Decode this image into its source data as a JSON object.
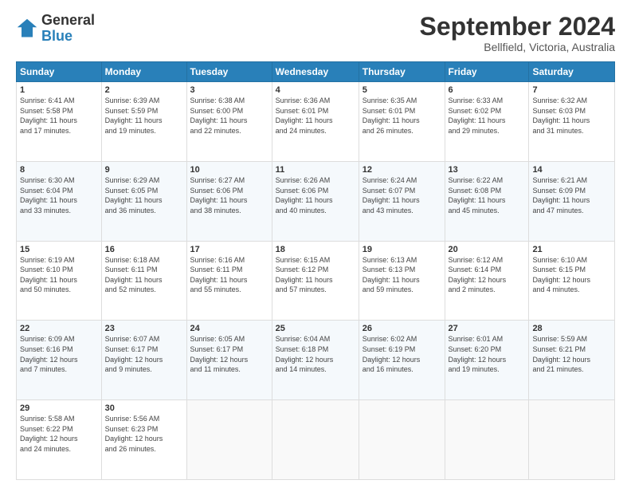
{
  "header": {
    "logo_line1": "General",
    "logo_line2": "Blue",
    "month": "September 2024",
    "location": "Bellfield, Victoria, Australia"
  },
  "weekdays": [
    "Sunday",
    "Monday",
    "Tuesday",
    "Wednesday",
    "Thursday",
    "Friday",
    "Saturday"
  ],
  "weeks": [
    [
      {
        "day": "1",
        "info": "Sunrise: 6:41 AM\nSunset: 5:58 PM\nDaylight: 11 hours\nand 17 minutes."
      },
      {
        "day": "2",
        "info": "Sunrise: 6:39 AM\nSunset: 5:59 PM\nDaylight: 11 hours\nand 19 minutes."
      },
      {
        "day": "3",
        "info": "Sunrise: 6:38 AM\nSunset: 6:00 PM\nDaylight: 11 hours\nand 22 minutes."
      },
      {
        "day": "4",
        "info": "Sunrise: 6:36 AM\nSunset: 6:01 PM\nDaylight: 11 hours\nand 24 minutes."
      },
      {
        "day": "5",
        "info": "Sunrise: 6:35 AM\nSunset: 6:01 PM\nDaylight: 11 hours\nand 26 minutes."
      },
      {
        "day": "6",
        "info": "Sunrise: 6:33 AM\nSunset: 6:02 PM\nDaylight: 11 hours\nand 29 minutes."
      },
      {
        "day": "7",
        "info": "Sunrise: 6:32 AM\nSunset: 6:03 PM\nDaylight: 11 hours\nand 31 minutes."
      }
    ],
    [
      {
        "day": "8",
        "info": "Sunrise: 6:30 AM\nSunset: 6:04 PM\nDaylight: 11 hours\nand 33 minutes."
      },
      {
        "day": "9",
        "info": "Sunrise: 6:29 AM\nSunset: 6:05 PM\nDaylight: 11 hours\nand 36 minutes."
      },
      {
        "day": "10",
        "info": "Sunrise: 6:27 AM\nSunset: 6:06 PM\nDaylight: 11 hours\nand 38 minutes."
      },
      {
        "day": "11",
        "info": "Sunrise: 6:26 AM\nSunset: 6:06 PM\nDaylight: 11 hours\nand 40 minutes."
      },
      {
        "day": "12",
        "info": "Sunrise: 6:24 AM\nSunset: 6:07 PM\nDaylight: 11 hours\nand 43 minutes."
      },
      {
        "day": "13",
        "info": "Sunrise: 6:22 AM\nSunset: 6:08 PM\nDaylight: 11 hours\nand 45 minutes."
      },
      {
        "day": "14",
        "info": "Sunrise: 6:21 AM\nSunset: 6:09 PM\nDaylight: 11 hours\nand 47 minutes."
      }
    ],
    [
      {
        "day": "15",
        "info": "Sunrise: 6:19 AM\nSunset: 6:10 PM\nDaylight: 11 hours\nand 50 minutes."
      },
      {
        "day": "16",
        "info": "Sunrise: 6:18 AM\nSunset: 6:11 PM\nDaylight: 11 hours\nand 52 minutes."
      },
      {
        "day": "17",
        "info": "Sunrise: 6:16 AM\nSunset: 6:11 PM\nDaylight: 11 hours\nand 55 minutes."
      },
      {
        "day": "18",
        "info": "Sunrise: 6:15 AM\nSunset: 6:12 PM\nDaylight: 11 hours\nand 57 minutes."
      },
      {
        "day": "19",
        "info": "Sunrise: 6:13 AM\nSunset: 6:13 PM\nDaylight: 11 hours\nand 59 minutes."
      },
      {
        "day": "20",
        "info": "Sunrise: 6:12 AM\nSunset: 6:14 PM\nDaylight: 12 hours\nand 2 minutes."
      },
      {
        "day": "21",
        "info": "Sunrise: 6:10 AM\nSunset: 6:15 PM\nDaylight: 12 hours\nand 4 minutes."
      }
    ],
    [
      {
        "day": "22",
        "info": "Sunrise: 6:09 AM\nSunset: 6:16 PM\nDaylight: 12 hours\nand 7 minutes."
      },
      {
        "day": "23",
        "info": "Sunrise: 6:07 AM\nSunset: 6:17 PM\nDaylight: 12 hours\nand 9 minutes."
      },
      {
        "day": "24",
        "info": "Sunrise: 6:05 AM\nSunset: 6:17 PM\nDaylight: 12 hours\nand 11 minutes."
      },
      {
        "day": "25",
        "info": "Sunrise: 6:04 AM\nSunset: 6:18 PM\nDaylight: 12 hours\nand 14 minutes."
      },
      {
        "day": "26",
        "info": "Sunrise: 6:02 AM\nSunset: 6:19 PM\nDaylight: 12 hours\nand 16 minutes."
      },
      {
        "day": "27",
        "info": "Sunrise: 6:01 AM\nSunset: 6:20 PM\nDaylight: 12 hours\nand 19 minutes."
      },
      {
        "day": "28",
        "info": "Sunrise: 5:59 AM\nSunset: 6:21 PM\nDaylight: 12 hours\nand 21 minutes."
      }
    ],
    [
      {
        "day": "29",
        "info": "Sunrise: 5:58 AM\nSunset: 6:22 PM\nDaylight: 12 hours\nand 24 minutes."
      },
      {
        "day": "30",
        "info": "Sunrise: 5:56 AM\nSunset: 6:23 PM\nDaylight: 12 hours\nand 26 minutes."
      },
      {
        "day": "",
        "info": ""
      },
      {
        "day": "",
        "info": ""
      },
      {
        "day": "",
        "info": ""
      },
      {
        "day": "",
        "info": ""
      },
      {
        "day": "",
        "info": ""
      }
    ]
  ]
}
